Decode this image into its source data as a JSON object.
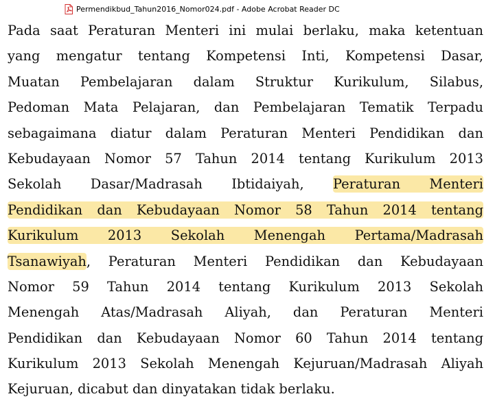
{
  "window": {
    "title": "Permendikbud_Tahun2016_Nomor024.pdf - Adobe Acrobat Reader DC",
    "icon": "pdf-file-icon",
    "icon_color": "#d32f2f"
  },
  "document": {
    "highlight_color": "#fbe8a6",
    "lines": [
      {
        "before": "Pada saat Peraturan Menteri ini mulai berlaku, maka ketentuan",
        "hl": "",
        "after": ""
      },
      {
        "before": "yang mengatur tentang Kompetensi Inti, Kompetensi Dasar,",
        "hl": "",
        "after": ""
      },
      {
        "before": "Muatan Pembelajaran dalam Struktur Kurikulum, Silabus,",
        "hl": "",
        "after": ""
      },
      {
        "before": "Pedoman Mata Pelajaran, dan Pembelajaran Tematik Terpadu",
        "hl": "",
        "after": ""
      },
      {
        "before": "sebagaimana diatur dalam Peraturan Menteri Pendidikan dan",
        "hl": "",
        "after": ""
      },
      {
        "before": "Kebudayaan Nomor 57 Tahun 2014 tentang Kurikulum 2013",
        "hl": "",
        "after": ""
      },
      {
        "before": "Sekolah Dasar/Madrasah Ibtidaiyah, ",
        "hl": "Peraturan Menteri",
        "after": ""
      },
      {
        "before": "",
        "hl": "Pendidikan dan Kebudayaan Nomor 58 Tahun 2014 tentang",
        "after": ""
      },
      {
        "before": "",
        "hl": "Kurikulum 2013 Sekolah Menengah Pertama/Madrasah",
        "after": ""
      },
      {
        "before": "",
        "hl": "Tsanawiyah",
        "after": ", Peraturan Menteri Pendidikan dan Kebudayaan"
      },
      {
        "before": "Nomor 59 Tahun 2014 tentang Kurikulum 2013 Sekolah",
        "hl": "",
        "after": ""
      },
      {
        "before": "Menengah Atas/Madrasah Aliyah, dan Peraturan Menteri",
        "hl": "",
        "after": ""
      },
      {
        "before": "Pendidikan dan Kebudayaan Nomor 60 Tahun 2014 tentang",
        "hl": "",
        "after": ""
      },
      {
        "before": "Kurikulum 2013 Sekolah Menengah Kejuruan/Madrasah Aliyah",
        "hl": "",
        "after": ""
      },
      {
        "before": "Kejuruan, dicabut dan dinyatakan tidak berlaku.",
        "hl": "",
        "after": ""
      }
    ]
  }
}
